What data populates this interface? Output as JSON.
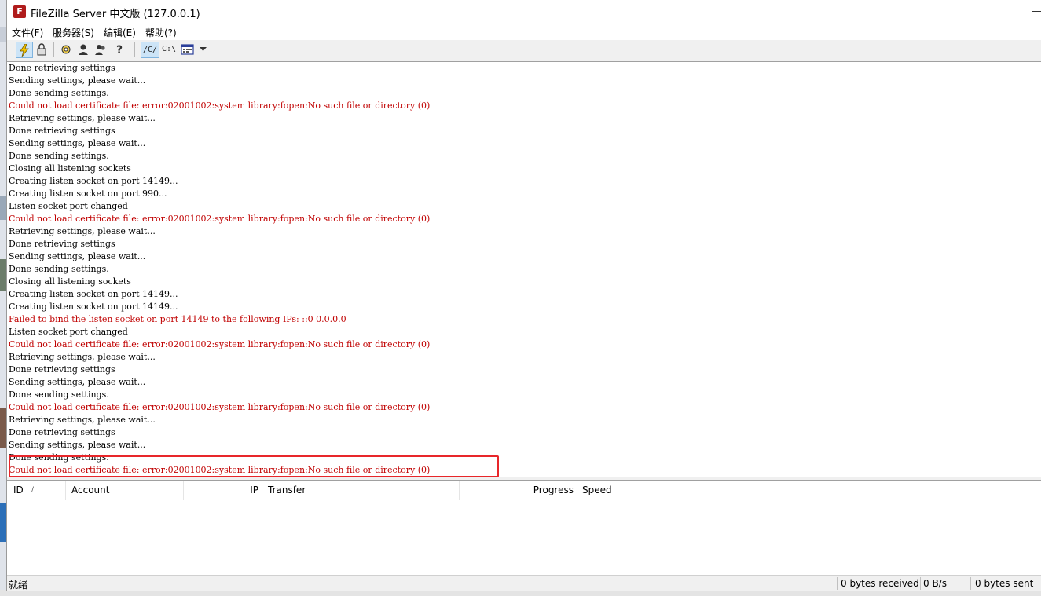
{
  "window": {
    "title": "FileZilla Server 中文版 (127.0.0.1)",
    "icon_letter": "Fz"
  },
  "menu": [
    "文件(F)",
    "服务器(S)",
    "编辑(E)",
    "帮助(?)"
  ],
  "toolbar": {
    "icons": [
      "lightning-icon",
      "lock-icon",
      "settings-icon",
      "users-icon",
      "groups-icon",
      "help-icon",
      "view-icon"
    ],
    "dir_unix_label": "/C/",
    "dir_win_label": "C:\\"
  },
  "log": [
    {
      "text": "Done retrieving settings",
      "type": "info"
    },
    {
      "text": "Sending settings, please wait...",
      "type": "info"
    },
    {
      "text": "Done sending settings.",
      "type": "info"
    },
    {
      "text": "Could not load certificate file: error:02001002:system library:fopen:No such file or directory (0)",
      "type": "error"
    },
    {
      "text": "Retrieving settings, please wait...",
      "type": "info"
    },
    {
      "text": "Done retrieving settings",
      "type": "info"
    },
    {
      "text": "Sending settings, please wait...",
      "type": "info"
    },
    {
      "text": "Done sending settings.",
      "type": "info"
    },
    {
      "text": "Closing all listening sockets",
      "type": "info"
    },
    {
      "text": "Creating listen socket on port 14149...",
      "type": "info"
    },
    {
      "text": "Creating listen socket on port 990...",
      "type": "info"
    },
    {
      "text": "Listen socket port changed",
      "type": "info"
    },
    {
      "text": "Could not load certificate file: error:02001002:system library:fopen:No such file or directory (0)",
      "type": "error"
    },
    {
      "text": "Retrieving settings, please wait...",
      "type": "info"
    },
    {
      "text": "Done retrieving settings",
      "type": "info"
    },
    {
      "text": "Sending settings, please wait...",
      "type": "info"
    },
    {
      "text": "Done sending settings.",
      "type": "info"
    },
    {
      "text": "Closing all listening sockets",
      "type": "info"
    },
    {
      "text": "Creating listen socket on port 14149...",
      "type": "info"
    },
    {
      "text": "Creating listen socket on port 14149...",
      "type": "info"
    },
    {
      "text": "Failed to bind the listen socket on port 14149 to the following IPs: ::0 0.0.0.0",
      "type": "error"
    },
    {
      "text": "Listen socket port changed",
      "type": "info"
    },
    {
      "text": "Could not load certificate file: error:02001002:system library:fopen:No such file or directory (0)",
      "type": "error"
    },
    {
      "text": "Retrieving settings, please wait...",
      "type": "info"
    },
    {
      "text": "Done retrieving settings",
      "type": "info"
    },
    {
      "text": "Sending settings, please wait...",
      "type": "info"
    },
    {
      "text": "Done sending settings.",
      "type": "info"
    },
    {
      "text": "Could not load certificate file: error:02001002:system library:fopen:No such file or directory (0)",
      "type": "error"
    },
    {
      "text": "Retrieving settings, please wait...",
      "type": "info"
    },
    {
      "text": "Done retrieving settings",
      "type": "info"
    },
    {
      "text": "Sending settings, please wait...",
      "type": "info"
    },
    {
      "text": "Done sending settings.",
      "type": "info"
    },
    {
      "text": "Could not load certificate file: error:02001002:system library:fopen:No such file or directory (0)",
      "type": "error"
    }
  ],
  "colors": {
    "error": "#c00000",
    "highlight": "#e8262a",
    "info": "#000000"
  },
  "transfers": {
    "columns": {
      "id": "ID",
      "sort_indicator": "/",
      "account": "Account",
      "ip": "IP",
      "transfer": "Transfer",
      "progress": "Progress",
      "speed": "Speed"
    }
  },
  "status": {
    "ready": "就绪",
    "bytes_received": "0 bytes received",
    "recv_speed": "0 B/s",
    "bytes_sent": "0 bytes sent"
  }
}
